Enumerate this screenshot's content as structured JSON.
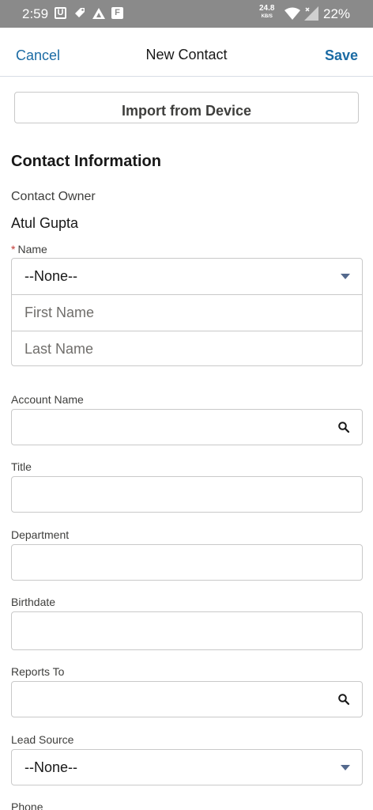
{
  "status_bar": {
    "time": "2:59",
    "net_speed": "24.8",
    "net_unit": "KB/S",
    "battery": "22%",
    "icons": [
      "u-app-icon",
      "tag-icon",
      "drive-icon",
      "f-app-icon",
      "wifi-icon",
      "signal-icon"
    ]
  },
  "header": {
    "cancel_label": "Cancel",
    "title": "New Contact",
    "save_label": "Save"
  },
  "import_button": "Import from Device",
  "section_title": "Contact Information",
  "owner": {
    "label": "Contact Owner",
    "value": "Atul Gupta"
  },
  "name": {
    "label": "Name",
    "required_mark": "*",
    "salutation": "--None--",
    "first_name_placeholder": "First Name",
    "last_name_placeholder": "Last Name"
  },
  "fields": {
    "account_name": "Account Name",
    "title": "Title",
    "department": "Department",
    "birthdate": "Birthdate",
    "reports_to": "Reports To",
    "lead_source": "Lead Source",
    "lead_source_value": "--None--",
    "phone": "Phone"
  },
  "colors": {
    "accent": "#1b6ba4",
    "required": "#c23934",
    "caret": "#54698d",
    "status_bar": "#8a8a8a"
  }
}
